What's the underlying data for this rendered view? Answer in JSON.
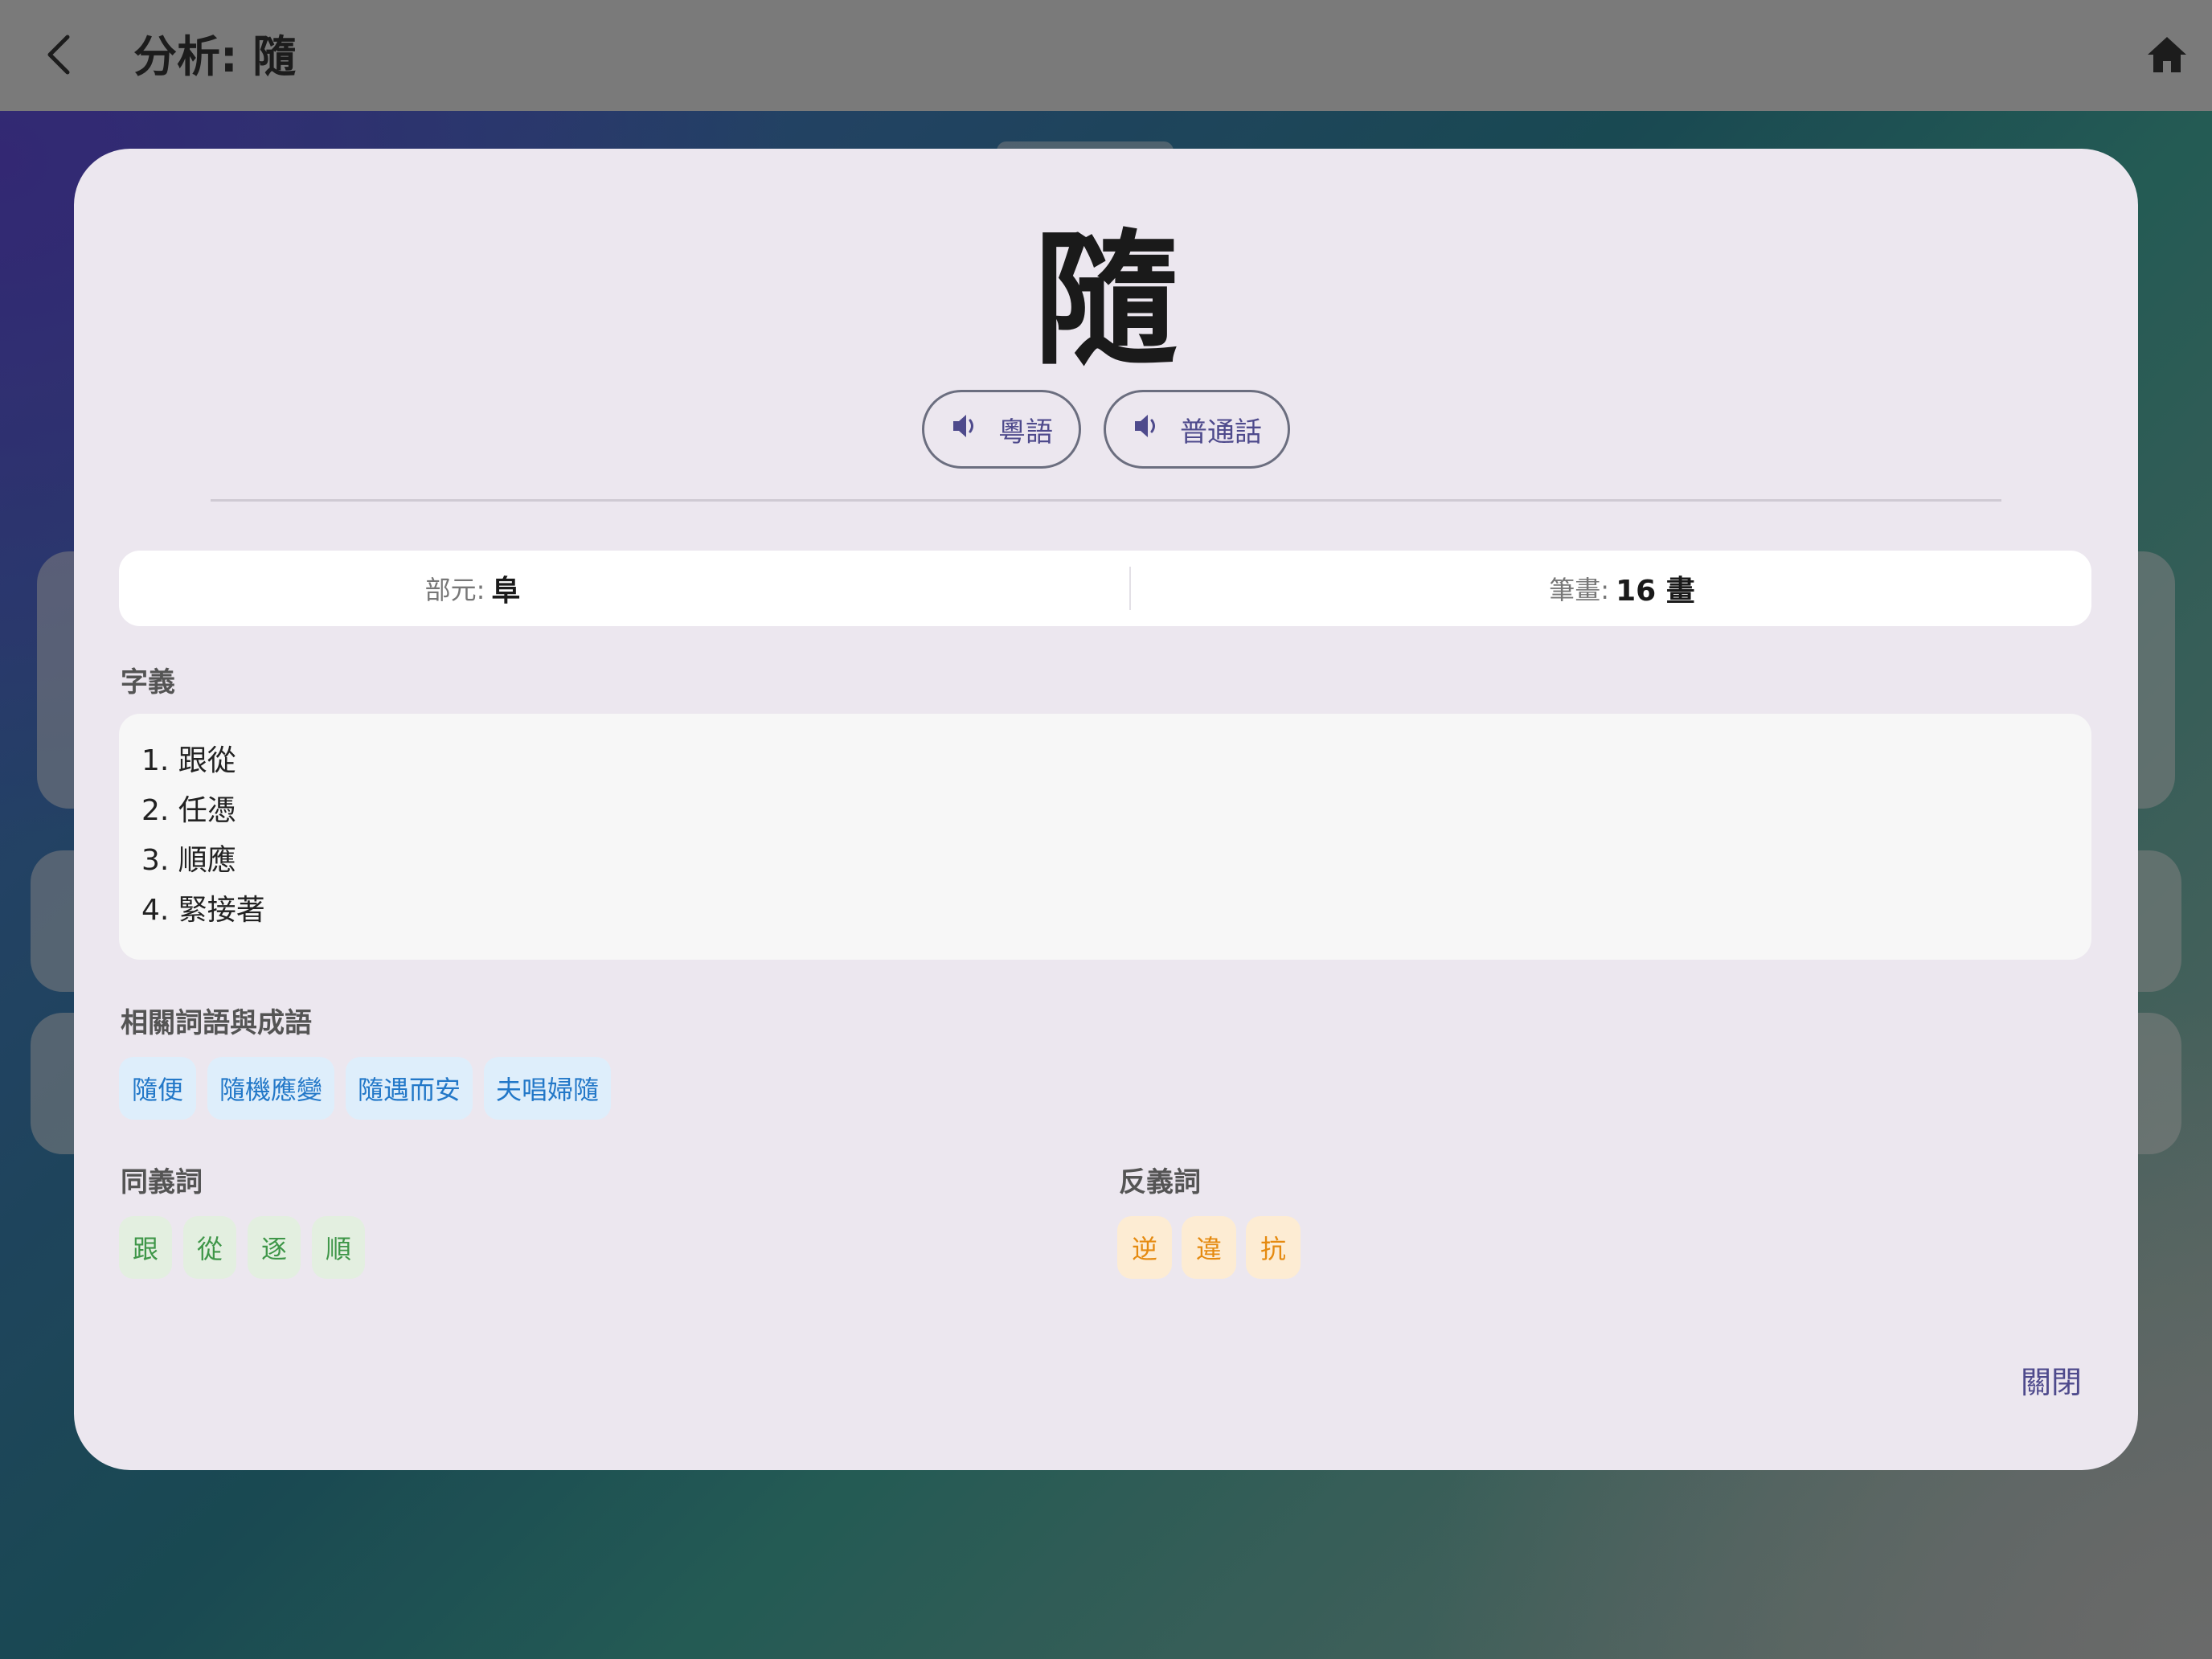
{
  "appbar": {
    "title": "分析: 隨"
  },
  "dialog": {
    "character": "隨",
    "audio_buttons": [
      {
        "label": "粵語",
        "icon": "volume-icon"
      },
      {
        "label": "普通話",
        "icon": "volume-icon"
      }
    ],
    "info": {
      "radical_label": "部元:",
      "radical_value": "阜",
      "strokes_label": "筆畫:",
      "strokes_value": "16 畫"
    },
    "meanings_title": "字義",
    "meanings": [
      "1. 跟從",
      "2. 任憑",
      "3. 順應",
      "4. 緊接著"
    ],
    "related_title": "相關詞語與成語",
    "related": [
      "隨便",
      "隨機應變",
      "隨遇而安",
      "夫唱婦隨"
    ],
    "synonyms_title": "同義詞",
    "synonyms": [
      "跟",
      "從",
      "逐",
      "順"
    ],
    "antonyms_title": "反義詞",
    "antonyms": [
      "逆",
      "違",
      "抗"
    ],
    "close_label": "關閉"
  },
  "colors": {
    "dialog_bg": "#ece7ef",
    "accent": "#4e4a8c",
    "related_chip": "#deeefb",
    "synonym_chip": "#e3efe0",
    "antonym_chip": "#fdecd3"
  }
}
